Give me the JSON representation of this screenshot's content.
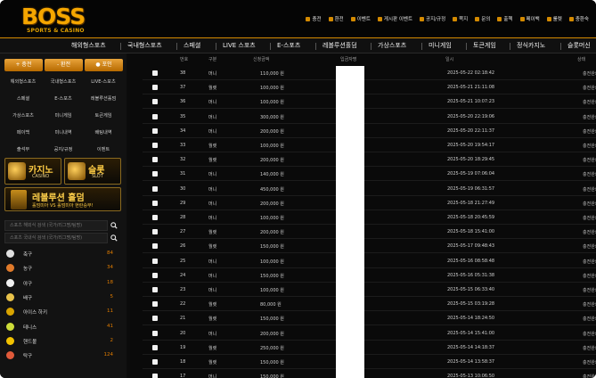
{
  "logo": {
    "main": "BOSS",
    "sub": "SPORTS & CASINO"
  },
  "toplinks": [
    "충전",
    "환전",
    "이벤트",
    "게시판 이벤트",
    "공지/규정",
    "쪽지",
    "문의",
    "출첵",
    "페이백",
    "룰렛",
    "충환숙"
  ],
  "nav": [
    "해외형스포츠",
    "국내형스포츠",
    "스페셜",
    "LIVE 스포츠",
    "E-스포츠",
    "레볼루션홀덤",
    "가상스포츠",
    "미니게임",
    "토큰게임",
    "정식카지노",
    "슬롯머신"
  ],
  "sidebar": {
    "buttons": [
      "+ 충전",
      "- 환전",
      "● 포인"
    ],
    "grid": [
      "해외형스포츠",
      "국내형스포츠",
      "LIVE-스포츠",
      "스페셜",
      "E-스포츠",
      "레볼루션홀덤",
      "가상스포츠",
      "미니게임",
      "토큰게임",
      "페이백",
      "미니내역",
      "배팅내역",
      "출석부",
      "공지/규정",
      "이벤트"
    ],
    "casino": {
      "title": "카지노",
      "sub": "CASINO"
    },
    "slot": {
      "title": "슬롯",
      "sub": "SLOT"
    },
    "holdem": {
      "title": "레볼루션 홀덤",
      "sub": "홀덤미아 VS 홀덤미아 현란승부!"
    },
    "search1": "스포츠 해외식 검색 (국가/리그명/팀명)",
    "search2": "스포츠 국내식 검색 (국가/리그명/팀명)",
    "sports": [
      {
        "name": "축구",
        "count": "84",
        "color": "#e0e0e0"
      },
      {
        "name": "농구",
        "count": "34",
        "color": "#e07a2a"
      },
      {
        "name": "야구",
        "count": "18",
        "color": "#f0f0f0"
      },
      {
        "name": "배구",
        "count": "5",
        "color": "#e8c24a"
      },
      {
        "name": "아이스 하키",
        "count": "11",
        "color": "#d9a400"
      },
      {
        "name": "테니스",
        "count": "41",
        "color": "#cddc39"
      },
      {
        "name": "핸드볼",
        "count": "2",
        "color": "#f2c200"
      },
      {
        "name": "탁구",
        "count": "124",
        "color": "#e05a3a"
      }
    ]
  },
  "table": {
    "headers": [
      "번호",
      "구분",
      "신청금액",
      "입금자명",
      "일시",
      "상태"
    ],
    "rows": [
      {
        "num": "38",
        "type": "머니",
        "amount": "110,000 원",
        "date": "2025-05-22 02:18:42",
        "status": "충전완료"
      },
      {
        "num": "37",
        "type": "월렛",
        "amount": "100,000 원",
        "date": "2025-05-21 21:11:08",
        "status": "충전완료"
      },
      {
        "num": "36",
        "type": "머니",
        "amount": "100,000 원",
        "date": "2025-05-21 10:07:23",
        "status": "충전완료"
      },
      {
        "num": "35",
        "type": "머니",
        "amount": "300,000 원",
        "date": "2025-05-20 22:19:06",
        "status": "충전완료"
      },
      {
        "num": "34",
        "type": "머니",
        "amount": "200,000 원",
        "date": "2025-05-20 22:11:37",
        "status": "충전완료"
      },
      {
        "num": "33",
        "type": "월렛",
        "amount": "100,000 원",
        "date": "2025-05-20 19:54:17",
        "status": "충전완료"
      },
      {
        "num": "32",
        "type": "월렛",
        "amount": "200,000 원",
        "date": "2025-05-20 18:29:45",
        "status": "충전완료"
      },
      {
        "num": "31",
        "type": "머니",
        "amount": "140,000 원",
        "date": "2025-05-19 07:06:04",
        "status": "충전완료"
      },
      {
        "num": "30",
        "type": "머니",
        "amount": "450,000 원",
        "date": "2025-05-19 06:31:57",
        "status": "충전완료"
      },
      {
        "num": "29",
        "type": "머니",
        "amount": "200,000 원",
        "date": "2025-05-18 21:27:49",
        "status": "충전완료"
      },
      {
        "num": "28",
        "type": "머니",
        "amount": "100,000 원",
        "date": "2025-05-18 20:45:59",
        "status": "충전완료"
      },
      {
        "num": "27",
        "type": "월렛",
        "amount": "200,000 원",
        "date": "2025-05-18 15:41:00",
        "status": "충전완료"
      },
      {
        "num": "26",
        "type": "월렛",
        "amount": "150,000 원",
        "date": "2025-05-17 09:48:43",
        "status": "충전완료"
      },
      {
        "num": "25",
        "type": "머니",
        "amount": "100,000 원",
        "date": "2025-05-16 08:58:48",
        "status": "충전완료"
      },
      {
        "num": "24",
        "type": "머니",
        "amount": "150,000 원",
        "date": "2025-05-16 05:31:38",
        "status": "충전완료"
      },
      {
        "num": "23",
        "type": "머니",
        "amount": "100,000 원",
        "date": "2025-05-15 06:33:40",
        "status": "충전완료"
      },
      {
        "num": "22",
        "type": "월렛",
        "amount": "80,000 원",
        "date": "2025-05-15 03:19:28",
        "status": "충전완료"
      },
      {
        "num": "21",
        "type": "월렛",
        "amount": "150,000 원",
        "date": "2025-05-14 18:24:50",
        "status": "충전완료"
      },
      {
        "num": "20",
        "type": "머니",
        "amount": "200,000 원",
        "date": "2025-05-14 15:41:00",
        "status": "충전완료"
      },
      {
        "num": "19",
        "type": "월렛",
        "amount": "250,000 원",
        "date": "2025-05-14 14:18:37",
        "status": "충전완료"
      },
      {
        "num": "18",
        "type": "월렛",
        "amount": "150,000 원",
        "date": "2025-05-14 13:58:37",
        "status": "충전완료"
      },
      {
        "num": "17",
        "type": "머니",
        "amount": "150,000 원",
        "date": "2025-05-13 10:06:50",
        "status": "충전완료"
      }
    ]
  }
}
